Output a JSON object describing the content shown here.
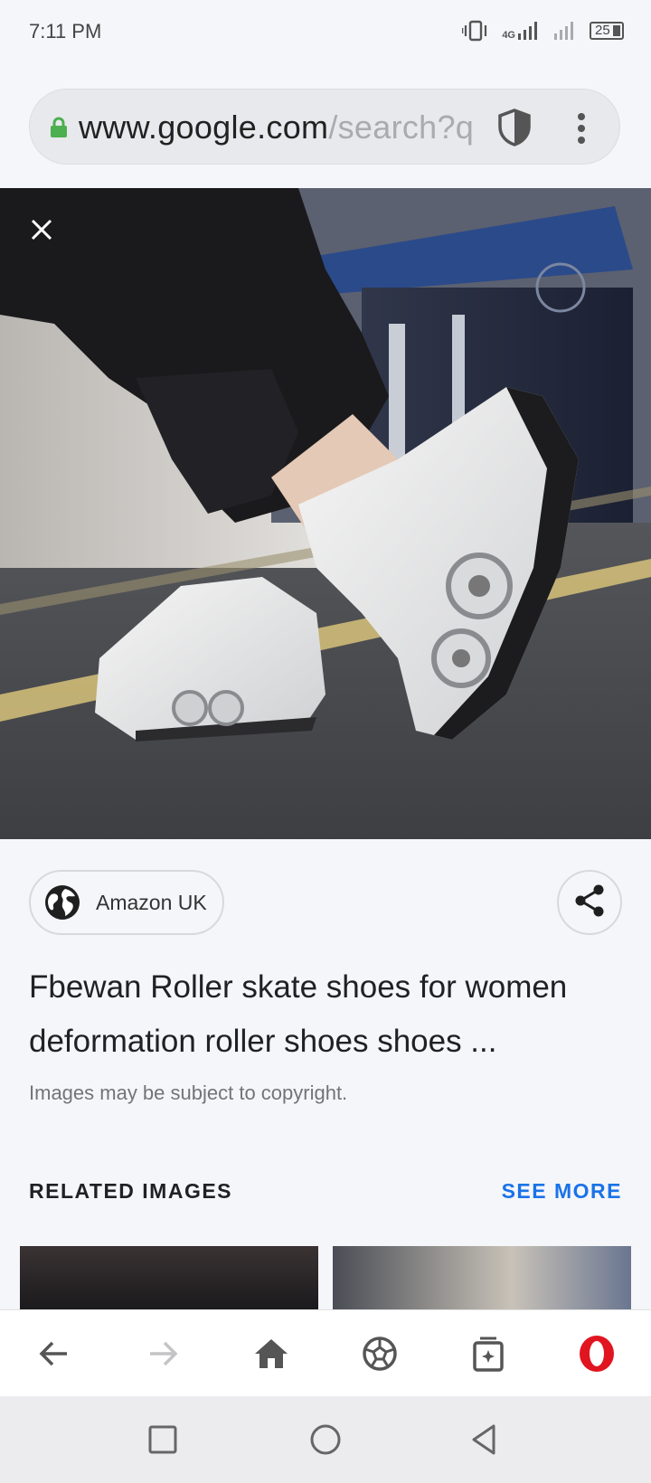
{
  "status_bar": {
    "time": "7:11 PM",
    "network": "4G",
    "battery": "25"
  },
  "url_bar": {
    "domain": "www.google.com",
    "path": "/search?q"
  },
  "result": {
    "source": "Amazon UK",
    "title": "Fbewan Roller skate shoes for women deformation roller shoes shoes ...",
    "copyright": "Images may be subject to copyright."
  },
  "related": {
    "heading": "RELATED IMAGES",
    "see_more": "SEE MORE"
  },
  "icons": {
    "lock": "lock-icon",
    "shield": "shield-icon",
    "menu": "more-vert-icon",
    "close": "close-icon",
    "globe": "globe-icon",
    "share": "share-icon",
    "back": "arrow-left-icon",
    "forward": "arrow-right-icon",
    "home": "home-icon",
    "speed_dial": "soccer-ball-icon",
    "tabs": "tabs-icon",
    "opera": "opera-logo-icon"
  },
  "colors": {
    "accent": "#1a73e8",
    "lock": "#4caf50",
    "opera": "#e0151f"
  }
}
